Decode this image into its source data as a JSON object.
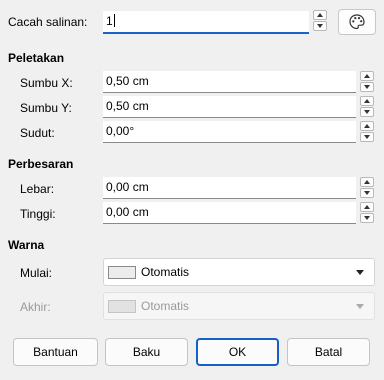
{
  "copies": {
    "label": "Cacah salinan:",
    "value": "1"
  },
  "placement": {
    "heading": "Peletakan",
    "x_axis": {
      "label": "Sumbu X:",
      "value": "0,50 cm"
    },
    "y_axis": {
      "label": "Sumbu Y:",
      "value": "0,50 cm"
    },
    "angle": {
      "label": "Sudut:",
      "value": "0,00°"
    }
  },
  "enlargement": {
    "heading": "Perbesaran",
    "width": {
      "label": "Lebar:",
      "value": "0,00 cm"
    },
    "height": {
      "label": "Tinggi:",
      "value": "0,00 cm"
    }
  },
  "colors": {
    "heading": "Warna",
    "start": {
      "label": "Mulai:",
      "value": "Otomatis"
    },
    "end": {
      "label": "Akhir:",
      "value": "Otomatis"
    }
  },
  "buttons": {
    "help": "Bantuan",
    "reset": "Baku",
    "ok": "OK",
    "cancel": "Batal"
  },
  "accent_color": "#1a63c9",
  "icons": {
    "values_from_selection": "palette-icon"
  }
}
